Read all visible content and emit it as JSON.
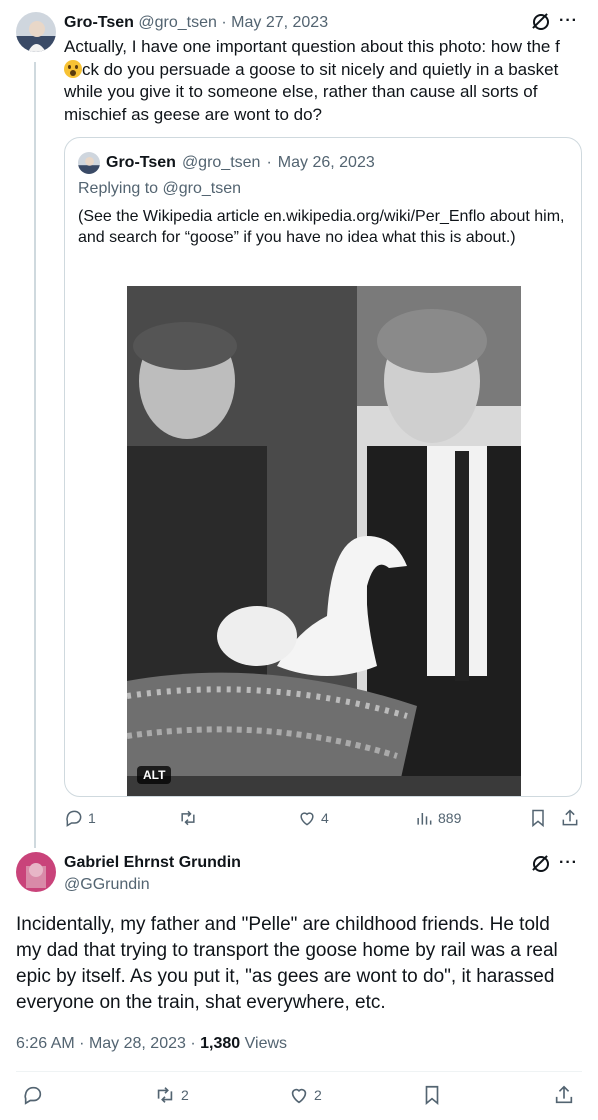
{
  "tweet1": {
    "author_name": "Gro-Tsen",
    "author_handle": "@gro_tsen",
    "separator": "·",
    "date": "May 27, 2023",
    "text_before_emoji": "Actually, I have one important question about this photo: how the f",
    "emoji": "astonished-face",
    "text_after_emoji": "ck do you persuade a goose to sit nicely and quietly in a basket while you give it to someone else, rather than cause all sorts of mischief as geese are wont to do?",
    "actions": {
      "replies": "1",
      "reposts": "",
      "likes": "4",
      "views": "889"
    }
  },
  "quote": {
    "author_name": "Gro-Tsen",
    "author_handle": "@gro_tsen",
    "separator": "·",
    "date": "May 26, 2023",
    "replying_prefix": "Replying to",
    "replying_handle": "@gro_tsen",
    "text": "(See the Wikipedia article en.wikipedia.org/wiki/Per_Enflo about him, and search for “goose” if you have no idea what this is about.)",
    "alt_badge": "ALT"
  },
  "tweet2": {
    "author_name": "Gabriel Ehrnst Grundin",
    "author_handle": "@GGrundin",
    "text": "Incidentally, my father and \"Pelle\" are childhood friends. He told my dad that trying to transport the goose home by rail was a real epic by itself. As you put it, \"as gees are wont to do\", it harassed everyone on the train, shat everywhere, etc.",
    "time": "6:26 AM",
    "separator": "·",
    "date": "May 28, 2023",
    "views_count": "1,380",
    "views_label": "Views",
    "actions": {
      "replies": "",
      "reposts": "2",
      "likes": "2"
    }
  },
  "colors": {
    "text": "#0f1419",
    "muted": "#536471",
    "border": "#cfd9de"
  }
}
